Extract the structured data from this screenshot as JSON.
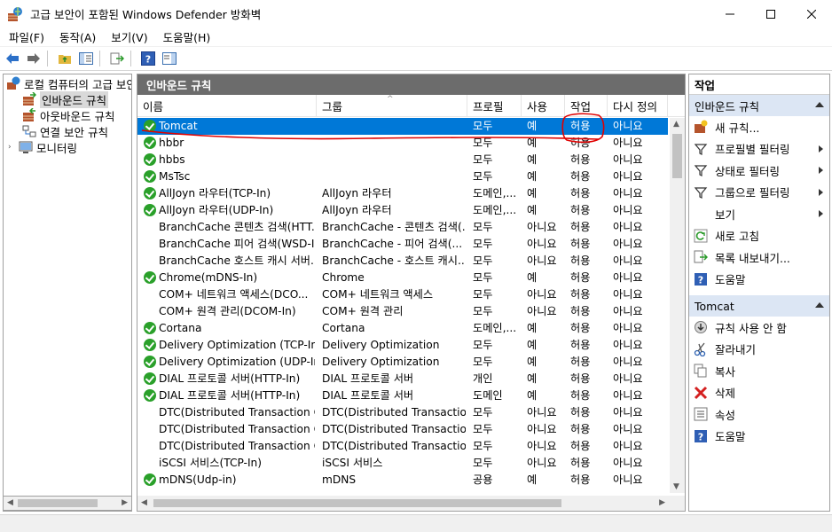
{
  "window": {
    "title": "고급 보안이 포함된 Windows Defender 방화벽"
  },
  "menu": [
    "파일(F)",
    "동작(A)",
    "보기(V)",
    "도움말(H)"
  ],
  "tree": {
    "root": "로컬 컴퓨터의 고급 보안",
    "items": [
      "인바운드 규칙",
      "아웃바운드 규칙",
      "연결 보안 규칙",
      "모니터링"
    ]
  },
  "center": {
    "header": "인바운드 규칙",
    "columns": [
      "이름",
      "그룹",
      "프로필",
      "사용",
      "작업",
      "다시 정의"
    ],
    "rows": [
      {
        "enabled": true,
        "name": "Tomcat",
        "group": "",
        "profile": "모두",
        "use": "예",
        "action": "허용",
        "override": "아니요"
      },
      {
        "enabled": true,
        "name": "hbbr",
        "group": "",
        "profile": "모두",
        "use": "예",
        "action": "허용",
        "override": "아니요"
      },
      {
        "enabled": true,
        "name": "hbbs",
        "group": "",
        "profile": "모두",
        "use": "예",
        "action": "허용",
        "override": "아니요"
      },
      {
        "enabled": true,
        "name": "MsTsc",
        "group": "",
        "profile": "모두",
        "use": "예",
        "action": "허용",
        "override": "아니요"
      },
      {
        "enabled": true,
        "name": "AllJoyn 라우터(TCP-In)",
        "group": "AllJoyn 라우터",
        "profile": "도메인,...",
        "use": "예",
        "action": "허용",
        "override": "아니요"
      },
      {
        "enabled": true,
        "name": "AllJoyn 라우터(UDP-In)",
        "group": "AllJoyn 라우터",
        "profile": "도메인,...",
        "use": "예",
        "action": "허용",
        "override": "아니요"
      },
      {
        "enabled": false,
        "name": "BranchCache 콘텐츠 검색(HTT...",
        "group": "BranchCache - 콘텐츠 검색(...",
        "profile": "모두",
        "use": "아니요",
        "action": "허용",
        "override": "아니요"
      },
      {
        "enabled": false,
        "name": "BranchCache 피어 검색(WSD-In)",
        "group": "BranchCache - 피어 검색(...",
        "profile": "모두",
        "use": "아니요",
        "action": "허용",
        "override": "아니요"
      },
      {
        "enabled": false,
        "name": "BranchCache 호스트 캐시 서버...",
        "group": "BranchCache - 호스트 캐시...",
        "profile": "모두",
        "use": "아니요",
        "action": "허용",
        "override": "아니요"
      },
      {
        "enabled": true,
        "name": "Chrome(mDNS-In)",
        "group": "Chrome",
        "profile": "모두",
        "use": "예",
        "action": "허용",
        "override": "아니요"
      },
      {
        "enabled": false,
        "name": "COM+ 네트워크 액세스(DCO...",
        "group": "COM+ 네트워크 액세스",
        "profile": "모두",
        "use": "아니요",
        "action": "허용",
        "override": "아니요"
      },
      {
        "enabled": false,
        "name": "COM+ 원격 관리(DCOM-In)",
        "group": "COM+ 원격 관리",
        "profile": "모두",
        "use": "아니요",
        "action": "허용",
        "override": "아니요"
      },
      {
        "enabled": true,
        "name": "Cortana",
        "group": "Cortana",
        "profile": "도메인,...",
        "use": "예",
        "action": "허용",
        "override": "아니요"
      },
      {
        "enabled": true,
        "name": "Delivery Optimization (TCP-In)",
        "group": "Delivery Optimization",
        "profile": "모두",
        "use": "예",
        "action": "허용",
        "override": "아니요"
      },
      {
        "enabled": true,
        "name": "Delivery Optimization (UDP-In)",
        "group": "Delivery Optimization",
        "profile": "모두",
        "use": "예",
        "action": "허용",
        "override": "아니요"
      },
      {
        "enabled": true,
        "name": "DIAL 프로토콜 서버(HTTP-In)",
        "group": "DIAL 프로토콜 서버",
        "profile": "개인",
        "use": "예",
        "action": "허용",
        "override": "아니요"
      },
      {
        "enabled": true,
        "name": "DIAL 프로토콜 서버(HTTP-In)",
        "group": "DIAL 프로토콜 서버",
        "profile": "도메인",
        "use": "예",
        "action": "허용",
        "override": "아니요"
      },
      {
        "enabled": false,
        "name": "DTC(Distributed Transaction C...",
        "group": "DTC(Distributed Transactio...",
        "profile": "모두",
        "use": "아니요",
        "action": "허용",
        "override": "아니요"
      },
      {
        "enabled": false,
        "name": "DTC(Distributed Transaction C...",
        "group": "DTC(Distributed Transactio...",
        "profile": "모두",
        "use": "아니요",
        "action": "허용",
        "override": "아니요"
      },
      {
        "enabled": false,
        "name": "DTC(Distributed Transaction C...",
        "group": "DTC(Distributed Transactio...",
        "profile": "모두",
        "use": "아니요",
        "action": "허용",
        "override": "아니요"
      },
      {
        "enabled": false,
        "name": "iSCSI 서비스(TCP-In)",
        "group": "iSCSI 서비스",
        "profile": "모두",
        "use": "아니요",
        "action": "허용",
        "override": "아니요"
      },
      {
        "enabled": true,
        "name": "mDNS(Udp-in)",
        "group": "mDNS",
        "profile": "공용",
        "use": "예",
        "action": "허용",
        "override": "아니요"
      }
    ]
  },
  "actions": {
    "header": "작업",
    "section1": "인바운드 규칙",
    "items1": [
      "새 규칙...",
      "프로필별 필터링",
      "상태로 필터링",
      "그룹으로 필터링",
      "보기",
      "새로 고침",
      "목록 내보내기...",
      "도움말"
    ],
    "section2": "Tomcat",
    "items2": [
      "규칙 사용 안 함",
      "잘라내기",
      "복사",
      "삭제",
      "속성",
      "도움말"
    ]
  },
  "colors": {
    "selection": "#0078d7",
    "annotation": "#e00000",
    "section_bg": "#dce6f4"
  }
}
